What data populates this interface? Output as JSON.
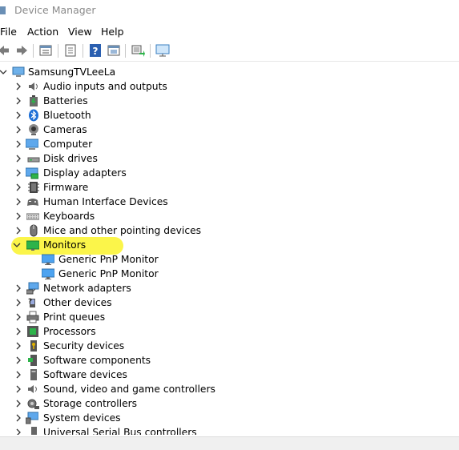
{
  "window": {
    "title": "Device Manager"
  },
  "menu": [
    "File",
    "Action",
    "View",
    "Help"
  ],
  "toolbar": [
    "back-icon",
    "forward-icon",
    "properties-icon",
    "update-driver-icon",
    "help-icon",
    "show-hidden-icon",
    "scan-hardware-icon",
    "monitor-icon"
  ],
  "tree": {
    "root": "SamsungTVLeeLa",
    "categories": [
      {
        "label": "Audio inputs and outputs",
        "icon": "speaker-icon"
      },
      {
        "label": "Batteries",
        "icon": "battery-icon"
      },
      {
        "label": "Bluetooth",
        "icon": "bluetooth-icon"
      },
      {
        "label": "Cameras",
        "icon": "camera-icon"
      },
      {
        "label": "Computer",
        "icon": "computer-icon"
      },
      {
        "label": "Disk drives",
        "icon": "disk-icon"
      },
      {
        "label": "Display adapters",
        "icon": "display-adapter-icon"
      },
      {
        "label": "Firmware",
        "icon": "firmware-icon"
      },
      {
        "label": "Human Interface Devices",
        "icon": "hid-icon"
      },
      {
        "label": "Keyboards",
        "icon": "keyboard-icon"
      },
      {
        "label": "Mice and other pointing devices",
        "icon": "mouse-icon"
      },
      {
        "label": "Monitors",
        "icon": "monitor-icon",
        "expanded": true,
        "children": [
          "Generic PnP Monitor",
          "Generic PnP Monitor"
        ]
      },
      {
        "label": "Network adapters",
        "icon": "network-icon"
      },
      {
        "label": "Other devices",
        "icon": "other-devices-icon"
      },
      {
        "label": "Print queues",
        "icon": "printer-icon"
      },
      {
        "label": "Processors",
        "icon": "processor-icon"
      },
      {
        "label": "Security devices",
        "icon": "security-icon"
      },
      {
        "label": "Software components",
        "icon": "software-components-icon"
      },
      {
        "label": "Software devices",
        "icon": "software-devices-icon"
      },
      {
        "label": "Sound, video and game controllers",
        "icon": "sound-icon"
      },
      {
        "label": "Storage controllers",
        "icon": "storage-icon"
      },
      {
        "label": "System devices",
        "icon": "system-icon"
      },
      {
        "label": "Universal Serial Bus controllers",
        "icon": "usb-icon"
      }
    ]
  },
  "colors": {
    "highlight": "#fbf54a",
    "monitor_green": "#2db34a",
    "monitor_blue": "#2f8fe0"
  }
}
